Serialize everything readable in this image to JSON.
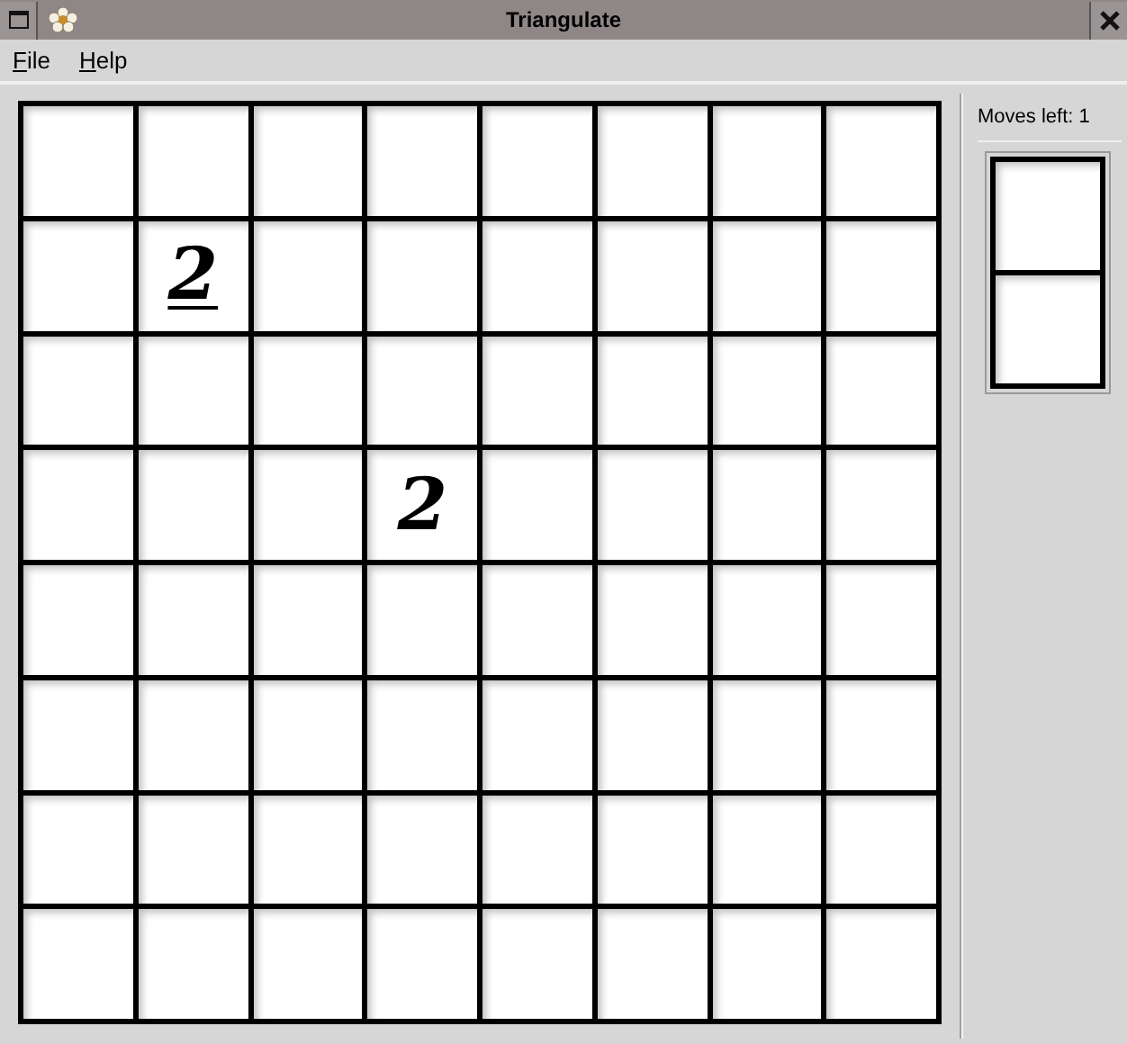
{
  "window": {
    "title": "Triangulate"
  },
  "menu": [
    {
      "label": "File"
    },
    {
      "label": "Help"
    }
  ],
  "board": {
    "rows": [
      [
        {
          "kind": "empty"
        },
        {
          "kind": "empty"
        },
        {
          "kind": "empty"
        },
        {
          "kind": "empty"
        },
        {
          "kind": "empty"
        },
        {
          "kind": "empty"
        },
        {
          "kind": "empty"
        },
        {
          "kind": "empty"
        }
      ],
      [
        {
          "kind": "empty"
        },
        {
          "kind": "number",
          "number": "2",
          "underlined": true
        },
        {
          "kind": "empty"
        },
        {
          "kind": "empty"
        },
        {
          "kind": "empty"
        },
        {
          "kind": "empty"
        },
        {
          "kind": "empty"
        },
        {
          "kind": "empty"
        }
      ],
      [
        {
          "kind": "empty"
        },
        {
          "kind": "empty"
        },
        {
          "kind": "empty"
        },
        {
          "kind": "empty"
        },
        {
          "kind": "empty"
        },
        {
          "kind": "empty"
        },
        {
          "kind": "empty"
        },
        {
          "kind": "empty"
        }
      ],
      [
        {
          "kind": "empty"
        },
        {
          "kind": "empty"
        },
        {
          "kind": "empty"
        },
        {
          "kind": "number",
          "number": "2",
          "underlined": false
        },
        {
          "kind": "empty"
        },
        {
          "kind": "empty"
        },
        {
          "kind": "empty"
        },
        {
          "kind": "empty"
        }
      ],
      [
        {
          "kind": "empty"
        },
        {
          "kind": "empty"
        },
        {
          "kind": "empty"
        },
        {
          "kind": "empty"
        },
        {
          "kind": "empty"
        },
        {
          "kind": "empty"
        },
        {
          "kind": "empty"
        },
        {
          "kind": "empty"
        }
      ],
      [
        {
          "kind": "empty"
        },
        {
          "kind": "empty"
        },
        {
          "kind": "empty"
        },
        {
          "kind": "empty"
        },
        {
          "kind": "empty"
        },
        {
          "kind": "empty"
        },
        {
          "kind": "empty"
        },
        {
          "kind": "empty"
        }
      ],
      [
        {
          "kind": "empty"
        },
        {
          "kind": "empty"
        },
        {
          "kind": "empty"
        },
        {
          "kind": "empty"
        },
        {
          "kind": "empty"
        },
        {
          "kind": "empty"
        },
        {
          "kind": "empty"
        },
        {
          "kind": "empty"
        }
      ],
      [
        {
          "kind": "empty"
        },
        {
          "kind": "empty"
        },
        {
          "kind": "empty"
        },
        {
          "kind": "empty"
        },
        {
          "kind": "empty"
        },
        {
          "kind": "empty"
        },
        {
          "kind": "empty"
        },
        {
          "kind": "empty"
        }
      ]
    ]
  },
  "side_panel": {
    "moves_left": "Moves left: 1",
    "preview": [
      {
        "kind": "empty"
      },
      {
        "kind": "empty"
      }
    ]
  }
}
